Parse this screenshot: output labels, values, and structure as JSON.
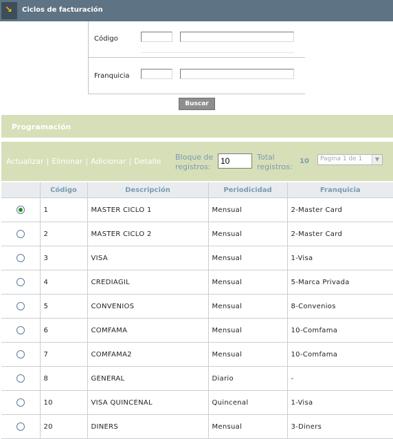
{
  "header": {
    "title": "Ciclos de facturación",
    "icon": "corner-arrow-icon"
  },
  "search": {
    "codigo_label": "Código",
    "codigo_value": "",
    "codigo_desc": "",
    "franquicia_label": "Franquicia",
    "franquicia_value": "",
    "franquicia_desc": "",
    "button_label": "Buscar"
  },
  "section": {
    "title": "Programación"
  },
  "toolbar": {
    "actions": [
      "Actualizar",
      "Eliminar",
      "Adicionar",
      "Detalle"
    ],
    "separator": "|",
    "block_label_1": "Bloque de",
    "block_label_2": "registros:",
    "block_value": "10",
    "total_label_1": "Total",
    "total_label_2": "registros:",
    "total_value": "10",
    "page_selector": "Pagina 1 de 1"
  },
  "table": {
    "columns": [
      "",
      "Código",
      "Descripción",
      "Periodicidad",
      "Franquicia"
    ],
    "selected_index": 0,
    "rows": [
      {
        "codigo": "1",
        "descripcion": "MASTER CICLO 1",
        "periodicidad": "Mensual",
        "franquicia": "2-Master Card"
      },
      {
        "codigo": "2",
        "descripcion": "MASTER CICLO 2",
        "periodicidad": "Mensual",
        "franquicia": "2-Master Card"
      },
      {
        "codigo": "3",
        "descripcion": "VISA",
        "periodicidad": "Mensual",
        "franquicia": "1-Visa"
      },
      {
        "codigo": "4",
        "descripcion": "CREDIAGIL",
        "periodicidad": "Mensual",
        "franquicia": "5-Marca Privada"
      },
      {
        "codigo": "5",
        "descripcion": "CONVENIOS",
        "periodicidad": "Mensual",
        "franquicia": "8-Convenios"
      },
      {
        "codigo": "6",
        "descripcion": "COMFAMA",
        "periodicidad": "Mensual",
        "franquicia": "10-Comfama"
      },
      {
        "codigo": "7",
        "descripcion": "COMFAMA2",
        "periodicidad": "Mensual",
        "franquicia": "10-Comfama"
      },
      {
        "codigo": "8",
        "descripcion": "GENERAL",
        "periodicidad": "Diario",
        "franquicia": "-"
      },
      {
        "codigo": "10",
        "descripcion": "VISA QUINCENAL",
        "periodicidad": "Quincenal",
        "franquicia": "1-Visa"
      },
      {
        "codigo": "20",
        "descripcion": "DINERS",
        "periodicidad": "Mensual",
        "franquicia": "3-Diners"
      }
    ]
  }
}
